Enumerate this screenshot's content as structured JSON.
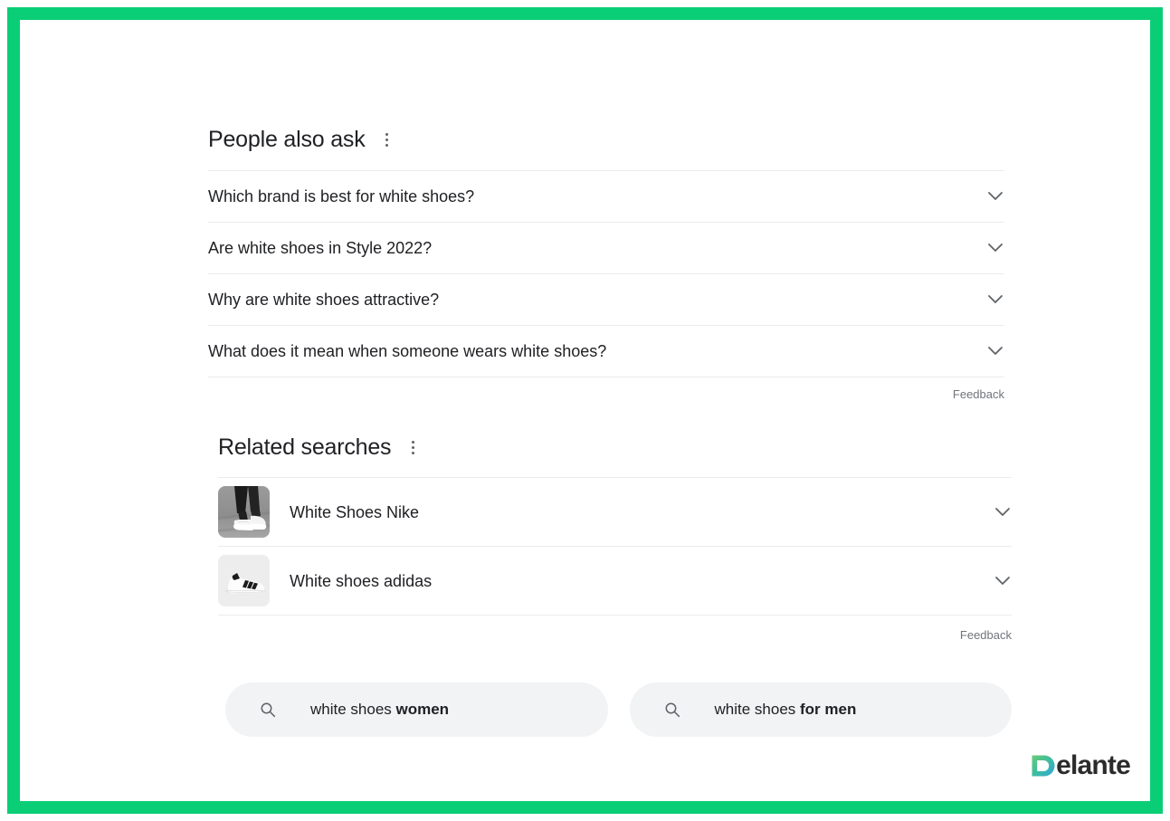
{
  "frame": {
    "border_color": "#0ACE76",
    "background": "#ffffff"
  },
  "people_also_ask": {
    "title": "People also ask",
    "menu_icon": "kebab-menu-icon",
    "questions": [
      {
        "text": "Which brand is best for white shoes?",
        "expand_icon": "chevron-down-icon"
      },
      {
        "text": "Are white shoes in Style 2022?",
        "expand_icon": "chevron-down-icon"
      },
      {
        "text": "Why are white shoes attractive?",
        "expand_icon": "chevron-down-icon"
      },
      {
        "text": "What does it mean when someone wears white shoes?",
        "expand_icon": "chevron-down-icon"
      }
    ],
    "feedback_label": "Feedback"
  },
  "related_searches": {
    "title": "Related searches",
    "menu_icon": "kebab-menu-icon",
    "items": [
      {
        "text": "White Shoes Nike",
        "thumbnail": "white-nike-sneakers-on-pavement-thumbnail",
        "expand_icon": "chevron-down-icon"
      },
      {
        "text": "White shoes adidas",
        "thumbnail": "white-adidas-superstar-sneaker-thumbnail",
        "expand_icon": "chevron-down-icon"
      }
    ],
    "feedback_label": "Feedback"
  },
  "query_chips": [
    {
      "icon": "search-icon",
      "prefix": "white shoes ",
      "highlight": "women"
    },
    {
      "icon": "search-icon",
      "prefix": "white shoes ",
      "highlight": "for men"
    }
  ],
  "logo": {
    "mark": "delante-d-mark",
    "word": "elante",
    "gradient_from": "#55C97E",
    "gradient_to": "#2BA7DC",
    "word_color": "#2b2b2b"
  },
  "colors": {
    "text_primary": "#202124",
    "text_muted": "#70757a",
    "divider": "#ebebeb",
    "chip_background": "#f1f3f4",
    "accent_green": "#0ACE76"
  }
}
